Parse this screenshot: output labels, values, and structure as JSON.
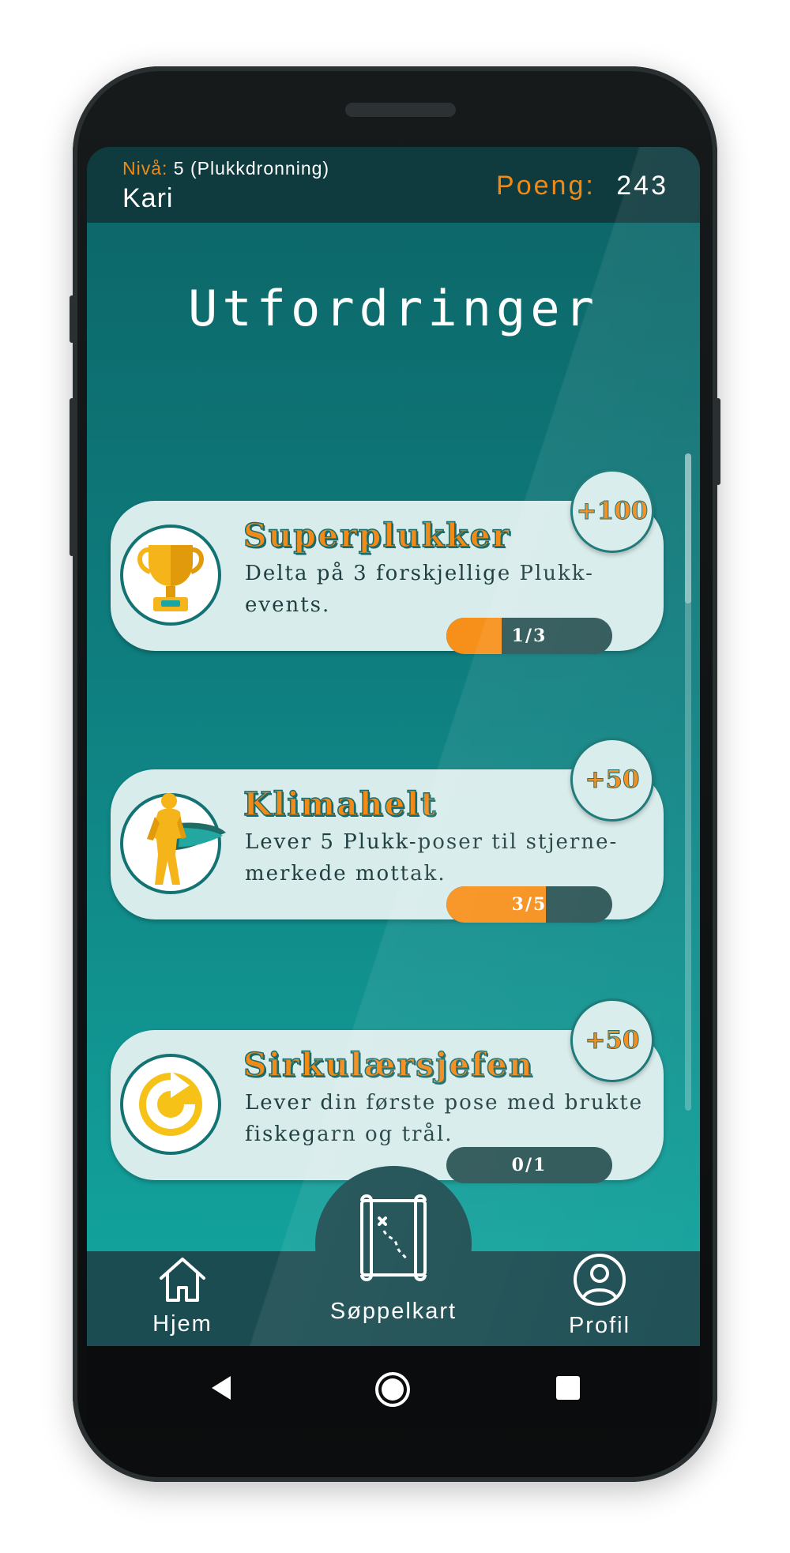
{
  "header": {
    "level_label": "Nivå:",
    "level_value": "5 (Plukkdronning)",
    "user_name": "Kari",
    "points_label": "Poeng:",
    "points_value": "243"
  },
  "page": {
    "title": "Utfordringer"
  },
  "challenges": [
    {
      "title": "Superplukker",
      "description": "Delta på 3 forskjellige Plukk-events.",
      "reward": "+100",
      "progress_label": "1/3",
      "progress_fraction": 0.333,
      "icon": "trophy-icon"
    },
    {
      "title": "Klimahelt",
      "description": "Lever 5 Plukk-poser til stjerne-merkede mottak.",
      "reward": "+50",
      "progress_label": "3/5",
      "progress_fraction": 0.6,
      "icon": "superhero-icon"
    },
    {
      "title": "Sirkulærsjefen",
      "description": "Lever din første pose med brukte fiskegarn og trål.",
      "reward": "+50",
      "progress_label": "0/1",
      "progress_fraction": 0,
      "icon": "recycle-arrow-icon"
    }
  ],
  "nav": {
    "home_label": "Hjem",
    "map_label": "Søppelkart",
    "profile_label": "Profil"
  },
  "colors": {
    "accent": "#f28a18",
    "header_bg": "#0f3b3f",
    "card_bg": "#d8ecec",
    "nav_bg": "#1a4c51"
  }
}
